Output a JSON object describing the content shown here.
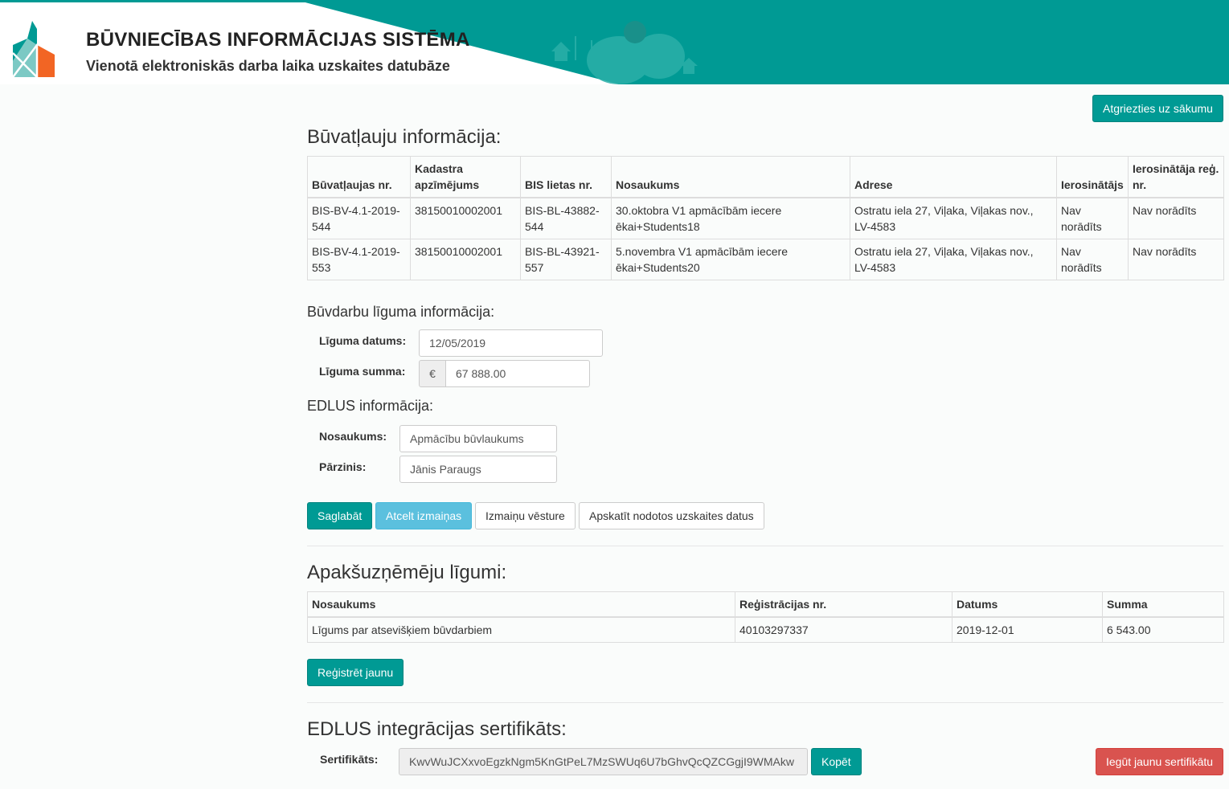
{
  "header": {
    "title": "BŪVNIECĪBAS INFORMĀCIJAS SISTĒMA",
    "subtitle": "Vienotā elektroniskās darba laika uzskaites datubāze",
    "accent_color": "#009a94",
    "logo_colors": [
      "#009a94",
      "#f26524"
    ]
  },
  "back_button": "Atgriezties uz sākumu",
  "permits": {
    "heading": "Būvatļauju informācija:",
    "columns": [
      "Būvatļaujas nr.",
      "Kadastra apzīmējums",
      "BIS lietas nr.",
      "Nosaukums",
      "Adrese",
      "Ierosinātājs",
      "Ierosinātāja reģ. nr."
    ],
    "rows": [
      [
        "BIS-BV-4.1-2019-544",
        "38150010002001",
        "BIS-BL-43882-544",
        "30.oktobra V1 apmācībām iecere ēkai+Students18",
        "Ostratu iela 27, Viļaka, Viļakas nov., LV-4583",
        "Nav norādīts",
        "Nav norādīts"
      ],
      [
        "BIS-BV-4.1-2019-553",
        "38150010002001",
        "BIS-BL-43921-557",
        "5.novembra V1 apmācībām iecere ēkai+Students20",
        "Ostratu iela 27, Viļaka, Viļakas nov., LV-4583",
        "Nav norādīts",
        "Nav norādīts"
      ]
    ]
  },
  "contract": {
    "heading": "Būvdarbu līguma informācija:",
    "date_label": "Līguma datums:",
    "date_value": "12/05/2019",
    "sum_label": "Līguma summa:",
    "currency": "€",
    "sum_value": "67 888.00"
  },
  "edlus": {
    "heading": "EDLUS informācija:",
    "name_label": "Nosaukums:",
    "name_value": "Apmācību būvlaukums",
    "manager_label": "Pārzinis:",
    "manager_value": "Jānis Paraugs"
  },
  "actions": {
    "save": "Saglabāt",
    "cancel": "Atcelt izmaiņas",
    "history": "Izmaiņu vēsture",
    "view_data": "Apskatīt nodotos uzskaites datus"
  },
  "subcontracts": {
    "heading": "Apakšuzņēmēju līgumi:",
    "columns": [
      "Nosaukums",
      "Reģistrācijas nr.",
      "Datums",
      "Summa"
    ],
    "rows": [
      [
        "Līgums par atsevišķiem būvdarbiem",
        "40103297337",
        "2019-12-01",
        "6 543.00"
      ]
    ],
    "register_button": "Reģistrēt jaunu"
  },
  "certificate": {
    "heading": "EDLUS integrācijas sertifikāts:",
    "label": "Sertifikāts:",
    "value": "KwvWuJCXxvoEgzkNgm5KnGtPeL7MzSWUq6U7bGhvQcQZCGgjI9WMAkw",
    "copy_button": "Kopēt",
    "new_button": "Iegūt jaunu sertifikātu"
  }
}
